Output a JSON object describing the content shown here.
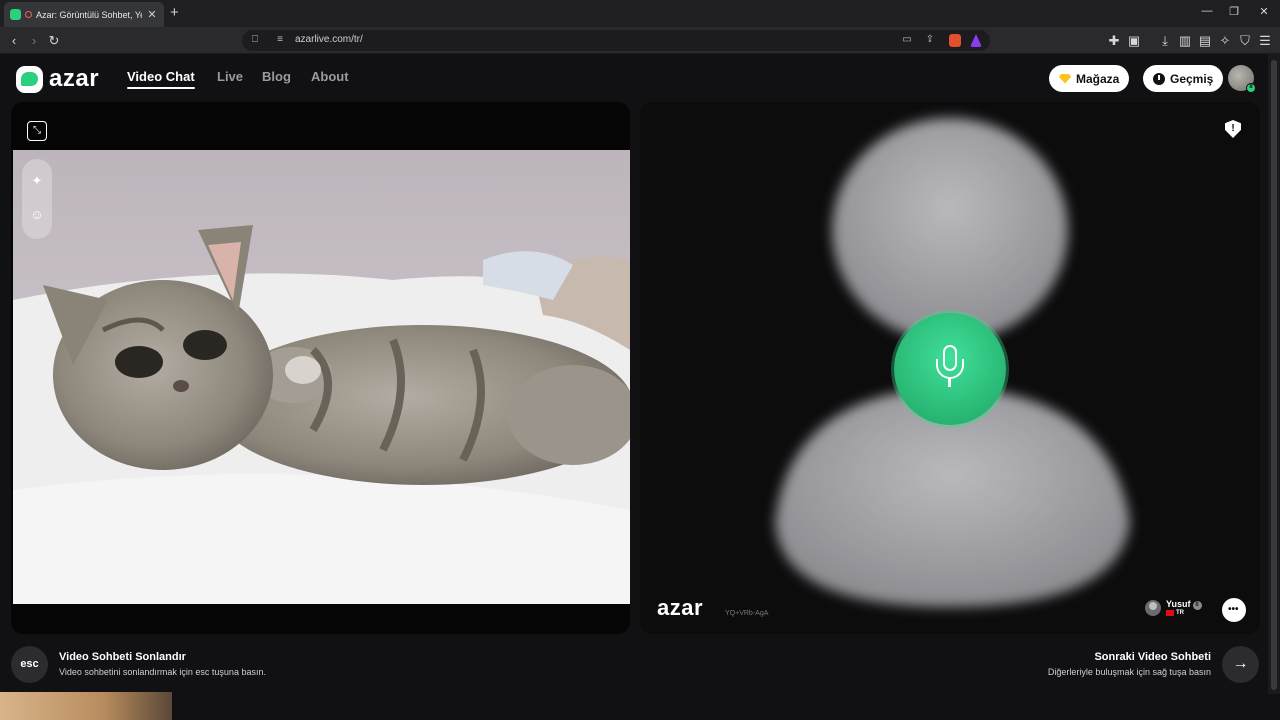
{
  "browser": {
    "tab_title": "Azar: Görüntülü Sohbet, Yeni",
    "url": "azarlive.com/tr/",
    "icons": {
      "tab_close": "close-icon",
      "new_tab": "plus-icon",
      "back": "chevron-left-icon",
      "forward": "chevron-right-icon",
      "reload": "reload-icon",
      "bookmark": "bookmark-icon",
      "site_settings": "tune-icon",
      "cast": "cast-icon",
      "share": "share-icon",
      "brave_shield": "brave-shield-icon",
      "brave_rewards": "brave-rewards-icon",
      "extensions": "puzzle-icon",
      "downloads": "download-icon",
      "sidebar": "sidebar-icon",
      "wallet": "wallet-icon",
      "leo": "sparkle-icon",
      "vpn": "shield-icon",
      "menu": "hamburger-icon"
    }
  },
  "site": {
    "logo": "azar",
    "nav": [
      {
        "label": "Video Chat",
        "active": true
      },
      {
        "label": "Live",
        "active": false
      },
      {
        "label": "Blog",
        "active": false
      },
      {
        "label": "About",
        "active": false
      }
    ],
    "store_label": "Mağaza",
    "history_label": "Geçmiş",
    "avatar_badge": "8",
    "accent": "#2bd07f",
    "gem_color": "#ffc21a"
  },
  "left_panel": {
    "icons": [
      "expand-icon",
      "sparkle-effects-icon",
      "face-mask-icon"
    ]
  },
  "right_panel": {
    "watermark": "azar",
    "watermark_id": "YQ+VRb-AgA",
    "partner_name": "Yusuf",
    "partner_badge": "8",
    "partner_country": "TR",
    "icons": [
      "report-shield-icon",
      "microphone-icon",
      "chat-icon"
    ]
  },
  "bottom": {
    "esc_key": "esc",
    "end_title": "Video Sohbeti Sonlandır",
    "end_sub": "Video sohbetini sonlandırmak için esc tuşuna basın.",
    "next_title": "Sonraki Video Sohbeti",
    "next_sub": "Diğerleriyle buluşmak için sağ tuşa basın",
    "next_icon": "arrow-right-icon"
  }
}
